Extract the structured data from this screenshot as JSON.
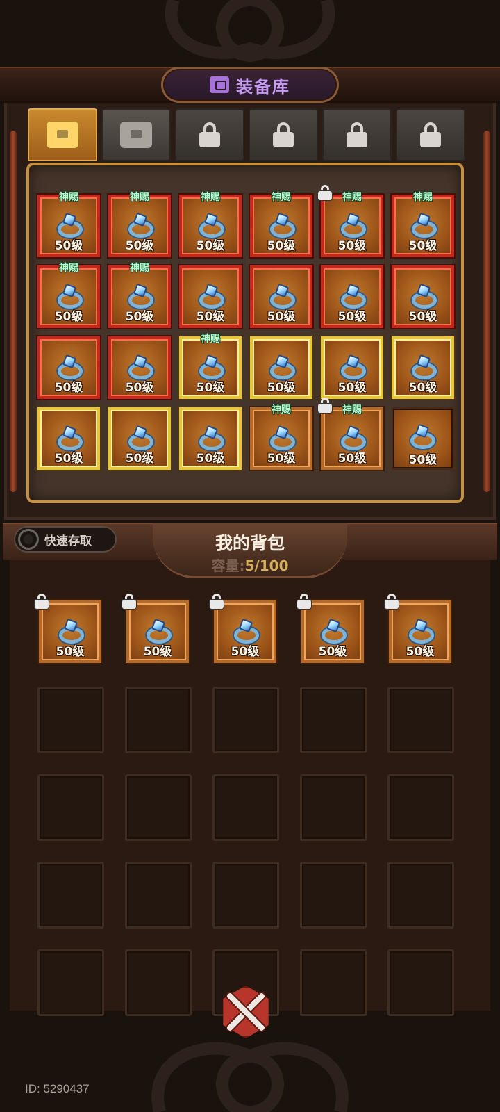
{
  "title": "装备库",
  "tabs": [
    {
      "state": "active",
      "icon": "chest-icon"
    },
    {
      "state": "available",
      "icon": "chest-icon"
    },
    {
      "state": "locked",
      "icon": "lock-icon"
    },
    {
      "state": "locked",
      "icon": "lock-icon"
    },
    {
      "state": "locked",
      "icon": "lock-icon"
    },
    {
      "state": "locked",
      "icon": "lock-icon"
    }
  ],
  "storage": {
    "items": [
      {
        "rarity": "red",
        "level": "50级",
        "tag": "神赐",
        "locked": false
      },
      {
        "rarity": "red",
        "level": "50级",
        "tag": "神赐",
        "locked": false
      },
      {
        "rarity": "red",
        "level": "50级",
        "tag": "神赐",
        "locked": false
      },
      {
        "rarity": "red",
        "level": "50级",
        "tag": "神赐",
        "locked": false
      },
      {
        "rarity": "red",
        "level": "50级",
        "tag": "神赐",
        "locked": true
      },
      {
        "rarity": "red",
        "level": "50级",
        "tag": "神赐",
        "locked": false
      },
      {
        "rarity": "red",
        "level": "50级",
        "tag": "神赐",
        "locked": false
      },
      {
        "rarity": "red",
        "level": "50级",
        "tag": "神赐",
        "locked": false
      },
      {
        "rarity": "red",
        "level": "50级",
        "tag": "",
        "locked": false
      },
      {
        "rarity": "red",
        "level": "50级",
        "tag": "",
        "locked": false
      },
      {
        "rarity": "red",
        "level": "50级",
        "tag": "",
        "locked": false
      },
      {
        "rarity": "red",
        "level": "50级",
        "tag": "",
        "locked": false
      },
      {
        "rarity": "red",
        "level": "50级",
        "tag": "",
        "locked": false
      },
      {
        "rarity": "red",
        "level": "50级",
        "tag": "",
        "locked": false
      },
      {
        "rarity": "gold",
        "level": "50级",
        "tag": "神赐",
        "locked": false
      },
      {
        "rarity": "gold",
        "level": "50级",
        "tag": "",
        "locked": false
      },
      {
        "rarity": "gold",
        "level": "50级",
        "tag": "",
        "locked": false
      },
      {
        "rarity": "gold",
        "level": "50级",
        "tag": "",
        "locked": false
      },
      {
        "rarity": "gold",
        "level": "50级",
        "tag": "",
        "locked": false
      },
      {
        "rarity": "gold",
        "level": "50级",
        "tag": "",
        "locked": false
      },
      {
        "rarity": "gold",
        "level": "50级",
        "tag": "",
        "locked": false
      },
      {
        "rarity": "bronze",
        "level": "50级",
        "tag": "神赐",
        "locked": false
      },
      {
        "rarity": "bronze",
        "level": "50级",
        "tag": "神赐",
        "locked": true
      },
      {
        "rarity": "plain",
        "level": "50级",
        "tag": "",
        "locked": false
      }
    ]
  },
  "backpack": {
    "title": "我的背包",
    "capacity_label": "容量:",
    "capacity_value": "5/100",
    "quick_access_label": "快速存取",
    "items": [
      {
        "rarity": "plain",
        "level": "50级",
        "locked": true
      },
      {
        "rarity": "plain",
        "level": "50级",
        "locked": true
      },
      {
        "rarity": "plain",
        "level": "50级",
        "locked": true
      },
      {
        "rarity": "plain",
        "level": "50级",
        "locked": true
      },
      {
        "rarity": "plain",
        "level": "50级",
        "locked": true
      }
    ],
    "empty_slots_visible": 20
  },
  "user_id": "ID: 5290437",
  "colors": {
    "title_purple": "#c69cf2",
    "divine_tag": "#b6ffcf",
    "rarity_red": "#c0291c",
    "rarity_gold": "#e7c53a",
    "capacity_value": "#d5b05e"
  }
}
